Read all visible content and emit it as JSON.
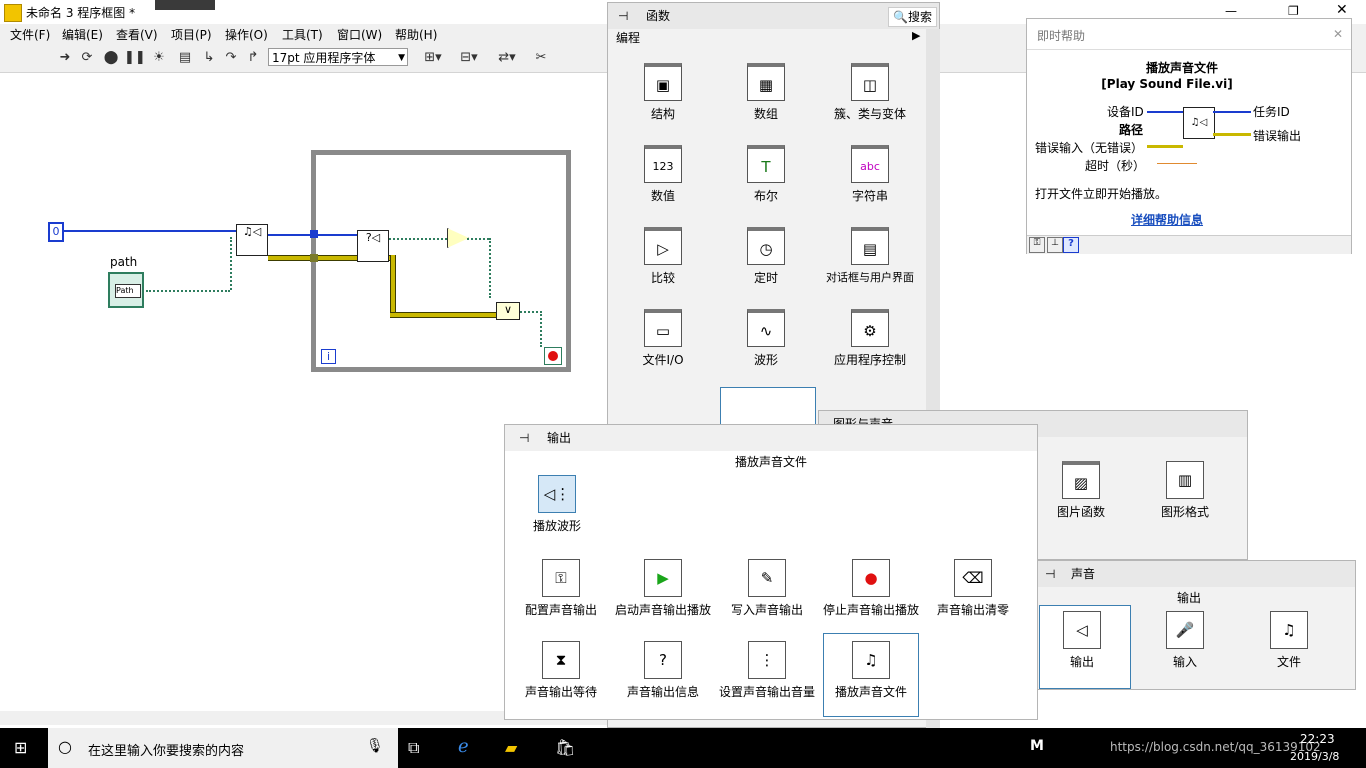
{
  "window": {
    "title": "未命名 3 程序框图 *"
  },
  "menu": [
    "文件(F)",
    "编辑(E)",
    "查看(V)",
    "项目(P)",
    "操作(O)",
    "工具(T)",
    "窗口(W)",
    "帮助(H)"
  ],
  "toolbar": {
    "font_select": "17pt 应用程序字体"
  },
  "diagram": {
    "const_value": "0",
    "path_label": "path",
    "path_text": "Path",
    "loop_index": "i"
  },
  "functions_palette": {
    "title": "函数",
    "search_label": "搜索",
    "category": "编程",
    "items": [
      {
        "label": "结构",
        "icon": "▣"
      },
      {
        "label": "数组",
        "icon": "▦"
      },
      {
        "label": "簇、类与变体",
        "icon": "◫"
      },
      {
        "label": "数值",
        "icon": "123"
      },
      {
        "label": "布尔",
        "icon": "T"
      },
      {
        "label": "字符串",
        "icon": "abc"
      },
      {
        "label": "比较",
        "icon": "▷"
      },
      {
        "label": "定时",
        "icon": "◷"
      },
      {
        "label": "对话框与用户界面",
        "icon": "▤"
      },
      {
        "label": "文件I/O",
        "icon": "▭"
      },
      {
        "label": "波形",
        "icon": "∿"
      },
      {
        "label": "应用程序控制",
        "icon": "⚙"
      }
    ]
  },
  "output_palette": {
    "title": "输出",
    "tooltip": "播放声音文件",
    "top_item": "播放波形",
    "items": [
      {
        "label": "配置声音输出",
        "icon": "⚿"
      },
      {
        "label": "启动声音输出播放",
        "icon": "▶"
      },
      {
        "label": "写入声音输出",
        "icon": "✎"
      },
      {
        "label": "停止声音输出播放",
        "icon": "●"
      },
      {
        "label": "声音输出清零",
        "icon": "⌫"
      },
      {
        "label": "声音输出等待",
        "icon": "⧗"
      },
      {
        "label": "声音输出信息",
        "icon": "?"
      },
      {
        "label": "设置声音输出音量",
        "icon": "⋮"
      },
      {
        "label": "播放声音文件",
        "icon": "♫"
      }
    ]
  },
  "graphics_palette": {
    "title": "图形与声音",
    "items": [
      {
        "label": "图片函数",
        "icon": "▨"
      },
      {
        "label": "图形格式",
        "icon": "▥"
      }
    ]
  },
  "sound_palette": {
    "title": "声音",
    "tooltip": "输出",
    "items": [
      {
        "label": "输出",
        "icon": "◁"
      },
      {
        "label": "输入",
        "icon": "🎤"
      },
      {
        "label": "文件",
        "icon": "♫"
      }
    ]
  },
  "help_window": {
    "title": "即时帮助",
    "func_name": "播放声音文件",
    "vi_name": "[Play Sound File.vi]",
    "left_terminals": [
      "设备ID",
      "路径",
      "错误输入（无错误）",
      "超时（秒）"
    ],
    "right_terminals": [
      "任务ID",
      "错误输出"
    ],
    "description": "打开文件立即开始播放。",
    "link": "详细帮助信息"
  },
  "taskbar": {
    "search_placeholder": "在这里输入你要搜索的内容",
    "time": "22:23",
    "date": "2019/3/8",
    "watermark": "https://blog.csdn.net/qq_36139102"
  },
  "colors": {
    "wire_blue": "#1a3ccf",
    "wire_green": "#2e7d5e",
    "wire_error": "#c9b800",
    "loop_gray": "#8a8a8a"
  }
}
